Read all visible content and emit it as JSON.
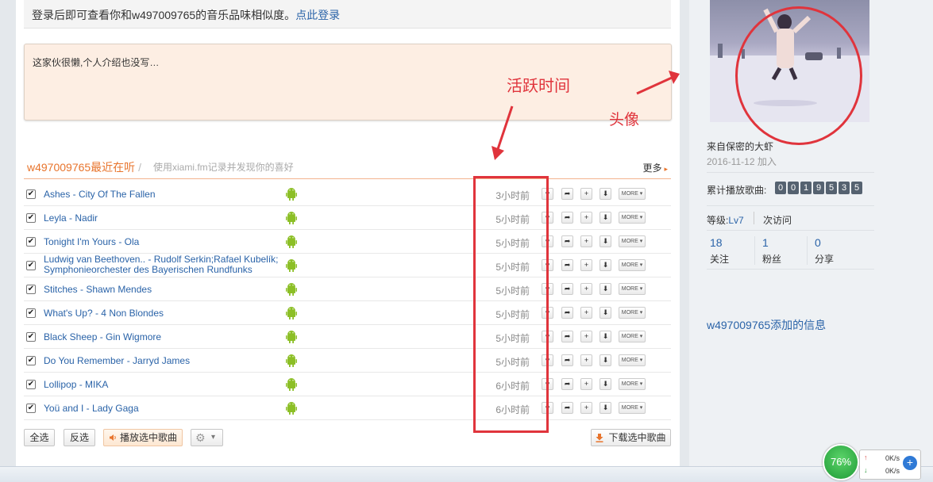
{
  "login_bar": {
    "text": "登录后即可查看你和w497009765的音乐品味相似度。",
    "link": "点此登录"
  },
  "intro": "这家伙很懒,个人介绍也没写…",
  "recent": {
    "title": "w497009765最近在听",
    "separator": "/",
    "hint": "使用xiami.fm记录并发现你的喜好",
    "more": "更多",
    "more_arrow": "▸",
    "check_mark": "✔",
    "more_button": "MORE ▾",
    "tracks": [
      {
        "title": "Ashes - City Of The Fallen",
        "time": "3小时前"
      },
      {
        "title": "Leyla - Nadir",
        "time": "5小时前"
      },
      {
        "title": "Tonight I'm Yours  - Ola",
        "time": "5小时前"
      },
      {
        "title": "Ludwig van Beethoven.. - Rudolf Serkin;Rafael Kubelík;",
        "title2": "Symphonieorchester des Bayerischen Rundfunks",
        "time": "5小时前"
      },
      {
        "title": "Stitches - Shawn Mendes",
        "time": "5小时前"
      },
      {
        "title": "What's Up? - 4 Non Blondes",
        "time": "5小时前"
      },
      {
        "title": "Black Sheep - Gin Wigmore",
        "time": "5小时前"
      },
      {
        "title": "Do You Remember  - Jarryd James",
        "time": "5小时前"
      },
      {
        "title": "Lollipop - MIKA",
        "time": "6小时前"
      },
      {
        "title": "Yoü and I - Lady Gaga",
        "time": "6小时前"
      }
    ]
  },
  "buttons": {
    "select_all": "全选",
    "invert": "反选",
    "play_selected": "播放选中歌曲",
    "settings_caret": "▾",
    "download_selected": "下载选中歌曲"
  },
  "annotations": {
    "active_time": "活跃时间",
    "avatar": "头像"
  },
  "profile": {
    "from": "来自保密的大虾",
    "join_date": "2016-11-12",
    "join_suffix": "加入",
    "play_count_label": "累计播放歌曲:",
    "play_count_digits": [
      "0",
      "0",
      "1",
      "9",
      "5",
      "3",
      "5"
    ],
    "level_label": "等级:",
    "level": "Lv7",
    "visits": "次访问",
    "stats": [
      {
        "value": "18",
        "label": "关注"
      },
      {
        "value": "1",
        "label": "粉丝"
      },
      {
        "value": "0",
        "label": "分享"
      }
    ],
    "added_info": "w497009765添加的信息"
  },
  "system_tray": {
    "percent": "76%",
    "up_speed": "0K/s",
    "down_speed": "0K/s",
    "up_arrow": "↑",
    "down_arrow": "↓",
    "plus": "+"
  },
  "colors": {
    "accent_orange": "#e8742c",
    "link_blue": "#2a63a8",
    "annotation_red": "#e0343c",
    "android_green": "#8cbf26"
  }
}
